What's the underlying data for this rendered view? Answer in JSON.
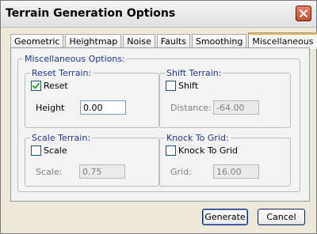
{
  "window": {
    "title": "Terrain Generation Options"
  },
  "tabs": [
    {
      "label": "Geometric"
    },
    {
      "label": "Heightmap"
    },
    {
      "label": "Noise"
    },
    {
      "label": "Faults"
    },
    {
      "label": "Smoothing"
    },
    {
      "label": "Miscellaneous",
      "selected": true
    }
  ],
  "misc": {
    "group_title": "Miscellaneous Options:",
    "reset_terrain": {
      "title": "Reset Terrain:",
      "checkbox_label": "Reset",
      "checked": true,
      "height_label": "Height",
      "height_value": "0.00"
    },
    "shift_terrain": {
      "title": "Shift Terrain:",
      "checkbox_label": "Shift",
      "checked": false,
      "distance_label": "Distance:",
      "distance_value": "-64.00"
    },
    "scale_terrain": {
      "title": "Scale Terrain:",
      "checkbox_label": "Scale",
      "checked": false,
      "scale_label": "Scale:",
      "scale_value": "0.75"
    },
    "knock_to_grid": {
      "title": "Knock To Grid:",
      "checkbox_label": "Knock To Grid",
      "checked": false,
      "grid_label": "Grid:",
      "grid_value": "16.00"
    }
  },
  "buttons": {
    "generate": "Generate",
    "cancel": "Cancel"
  },
  "icons": {
    "close": "close-icon",
    "check": "checkmark-icon"
  },
  "colors": {
    "group_title_blue": "#1f3a93",
    "check_green": "#2fa832",
    "close_red": "#c3512f"
  }
}
